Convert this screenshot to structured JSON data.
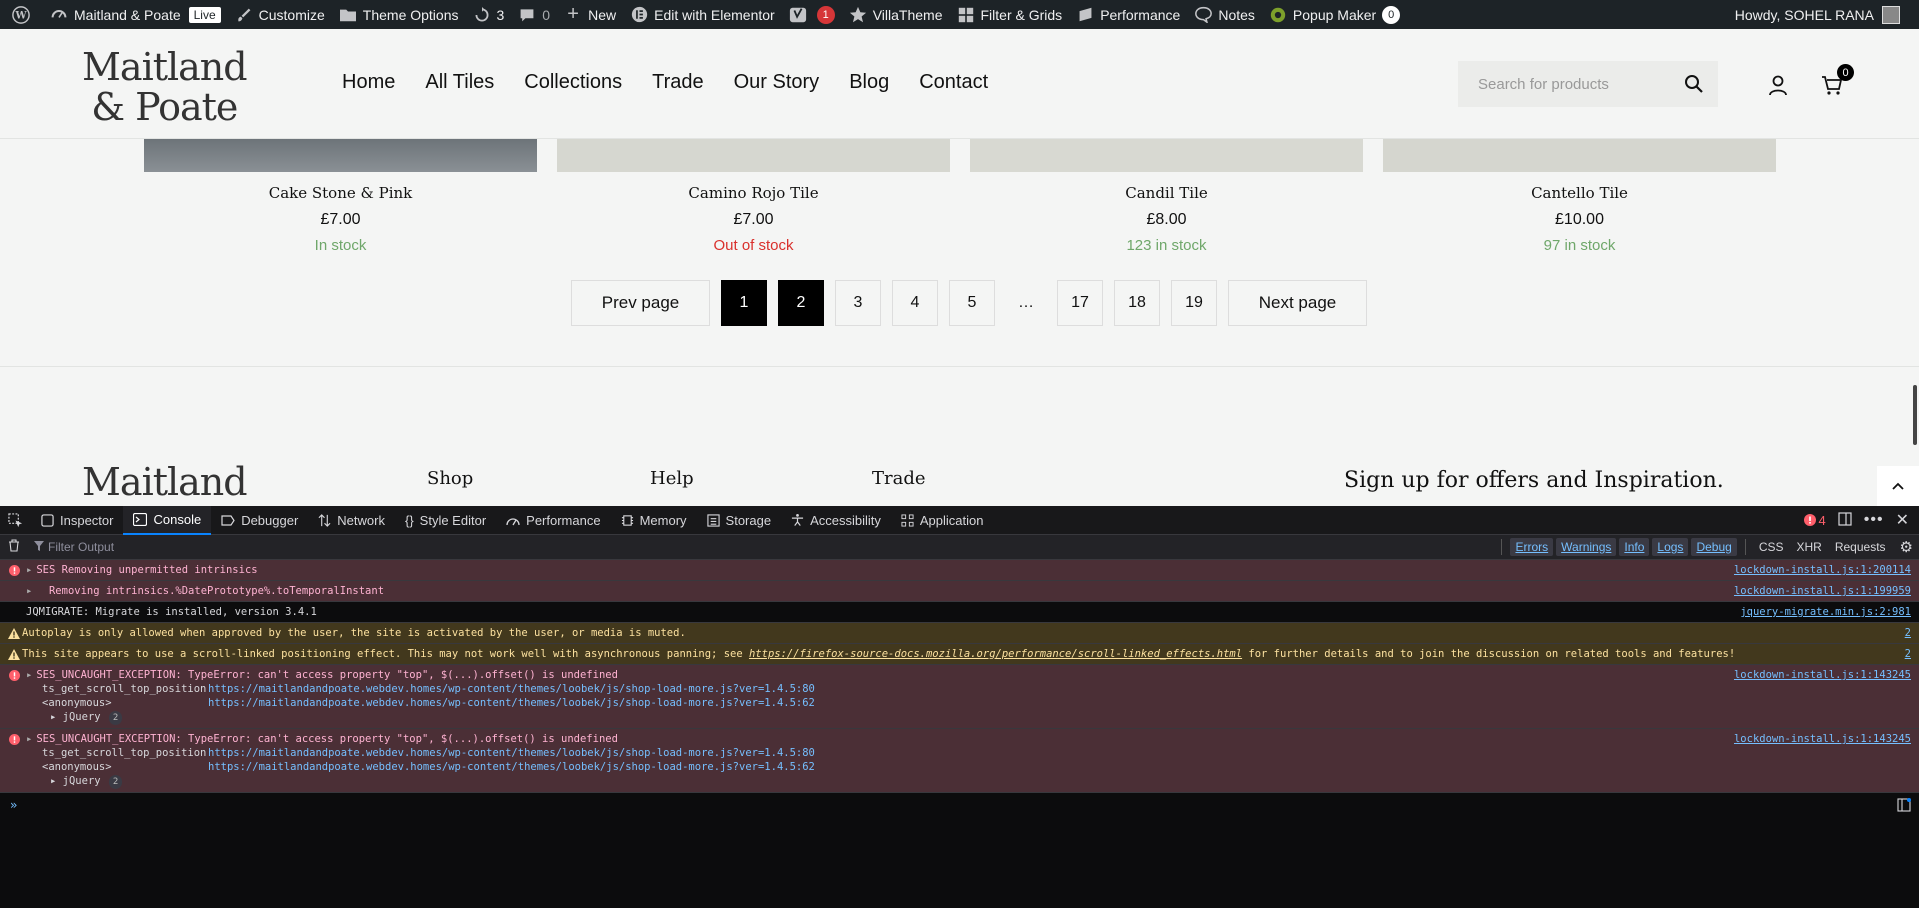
{
  "adminbar": {
    "site_name": "Maitland & Poate",
    "live": "Live",
    "customize": "Customize",
    "theme_options": "Theme Options",
    "updates": "3",
    "comments": "0",
    "new": "New",
    "elementor": "Edit with Elementor",
    "yoast_count": "1",
    "villatheme": "VillaTheme",
    "filter_grids": "Filter & Grids",
    "performance": "Performance",
    "notes": "Notes",
    "popup_maker": "Popup Maker",
    "popup_count": "0",
    "howdy": "Howdy, SOHEL RANA"
  },
  "header": {
    "logo_line1": "Maitland",
    "logo_line2": "& Poate",
    "nav": [
      "Home",
      "All Tiles",
      "Collections",
      "Trade",
      "Our Story",
      "Blog",
      "Contact"
    ],
    "search_placeholder": "Search for products",
    "cart_count": "0"
  },
  "products": [
    {
      "title": "Cake Stone & Pink",
      "price": "£7.00",
      "stock": "In stock",
      "stock_color": "#6fa76a"
    },
    {
      "title": "Camino Rojo Tile",
      "price": "£7.00",
      "stock": "Out of stock",
      "stock_color": "#d9302c"
    },
    {
      "title": "Candil Tile",
      "price": "£8.00",
      "stock": "123 in stock",
      "stock_color": "#6fa76a"
    },
    {
      "title": "Cantello Tile",
      "price": "£10.00",
      "stock": "97 in stock",
      "stock_color": "#6fa76a"
    }
  ],
  "pagination": {
    "prev": "Prev page",
    "pages": [
      "1",
      "2",
      "3",
      "4",
      "5",
      "…",
      "17",
      "18",
      "19"
    ],
    "next": "Next page"
  },
  "footer": {
    "logo": "Maitland",
    "shop": "Shop",
    "help": "Help",
    "trade": "Trade",
    "signup": "Sign up for offers and Inspiration."
  },
  "devtools": {
    "tabs": [
      "Inspector",
      "Console",
      "Debugger",
      "Network",
      "Style Editor",
      "Performance",
      "Memory",
      "Storage",
      "Accessibility",
      "Application"
    ],
    "error_count": "4",
    "filter_placeholder": "Filter Output",
    "filter_buttons": [
      "Errors",
      "Warnings",
      "Info",
      "Logs",
      "Debug",
      "CSS",
      "XHR",
      "Requests"
    ],
    "messages": {
      "m1": {
        "text": "SES Removing unpermitted intrinsics",
        "src": "lockdown-install.js:1:200114"
      },
      "m2": {
        "text": "Removing intrinsics.%DatePrototype%.toTemporalInstant",
        "src": "lockdown-install.js:1:199959"
      },
      "m3": {
        "text": "JQMIGRATE: Migrate is installed, version 3.4.1",
        "src": "jquery-migrate.min.js:2:981"
      },
      "m4": {
        "text": "Autoplay is only allowed when approved by the user, the site is activated by the user, or media is muted.",
        "src": "2"
      },
      "m5": {
        "text_before": "This site appears to use a scroll-linked positioning effect. This may not work well with asynchronous panning; see ",
        "link": "https://firefox-source-docs.mozilla.org/performance/scroll-linked_effects.html",
        "text_after": " for further details and to join the discussion on related tools and features!",
        "src": "2"
      },
      "m6": {
        "text": "SES_UNCAUGHT_EXCEPTION: TypeError: can't access property \"top\", $(...).offset() is undefined",
        "src": "lockdown-install.js:1:143245",
        "fn1": "ts_get_scroll_top_position",
        "loc1": "https://maitlandandpoate.webdev.homes/wp-content/themes/loobek/js/shop-load-more.js?ver=1.4.5:80",
        "fn2": "<anonymous>",
        "loc2": "https://maitlandandpoate.webdev.homes/wp-content/themes/loobek/js/shop-load-more.js?ver=1.4.5:62",
        "jq": "jQuery",
        "jq_count": "2"
      },
      "m7": {
        "text": "SES_UNCAUGHT_EXCEPTION: TypeError: can't access property \"top\", $(...).offset() is undefined",
        "src": "lockdown-install.js:1:143245",
        "fn1": "ts_get_scroll_top_position",
        "loc1": "https://maitlandandpoate.webdev.homes/wp-content/themes/loobek/js/shop-load-more.js?ver=1.4.5:80",
        "fn2": "<anonymous>",
        "loc2": "https://maitlandandpoate.webdev.homes/wp-content/themes/loobek/js/shop-load-more.js?ver=1.4.5:62",
        "jq": "jQuery",
        "jq_count": "2"
      }
    }
  }
}
